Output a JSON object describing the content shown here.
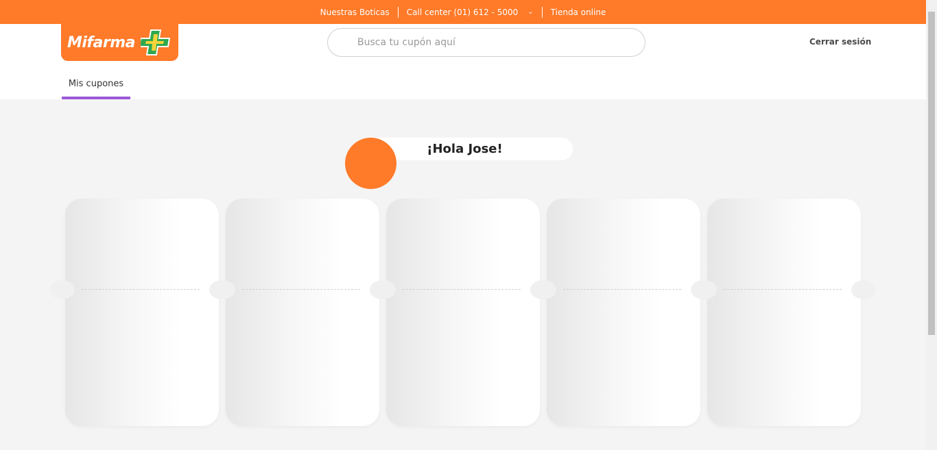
{
  "topbar": {
    "stores": "Nuestras Boticas",
    "call_center": "Call center (01) 612 - 5000",
    "store_online": "Tienda online"
  },
  "header": {
    "logo_text": "Mifarma",
    "search_placeholder": "Busca tu cupón aquí",
    "logout": "Cerrar sesión",
    "tab": "Mis cupones"
  },
  "greeting": "¡Hola Jose!",
  "colors": {
    "brand_orange": "#ff7a29",
    "tab_accent": "#9b59d6",
    "logo_cross_green": "#2fa84f",
    "logo_cross_yellow": "#f7d43a"
  },
  "coupons": [
    {},
    {},
    {},
    {},
    {}
  ]
}
